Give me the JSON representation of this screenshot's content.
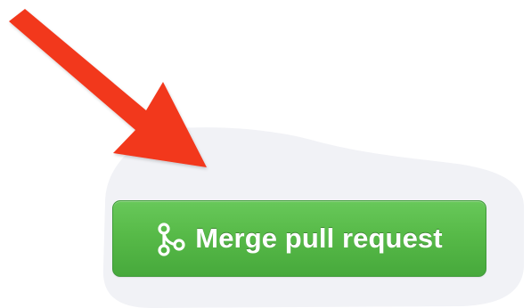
{
  "merge_button": {
    "label": "Merge pull request",
    "icon": "git-merge-icon"
  },
  "annotation": {
    "icon": "red-arrow-icon"
  },
  "colors": {
    "button_green": "#57ba48",
    "button_border": "#3f9a3a",
    "arrow_red": "#f2371f",
    "highlight_blob": "#f1f2f6",
    "label_text": "#ffffff"
  }
}
